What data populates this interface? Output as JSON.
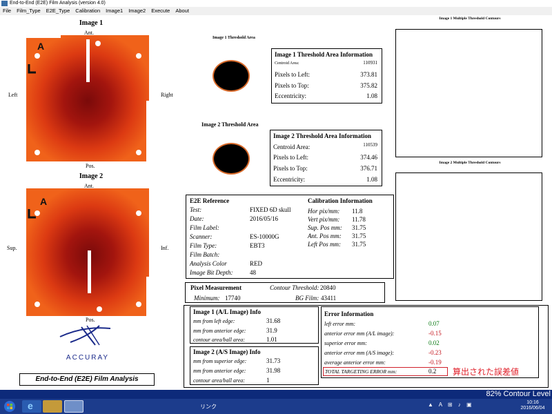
{
  "window": {
    "title": "End-to-End (E2E) Film Analysis (version 4.0)"
  },
  "menu": [
    "File",
    "Film_Type",
    "E2E_Type",
    "Calibration",
    "Image1",
    "Image2",
    "Execute",
    "About"
  ],
  "image1": {
    "title": "Image 1",
    "top": "Ant.",
    "bottom": "Pos.",
    "left": "Left",
    "right": "Right",
    "marker": "A"
  },
  "image2": {
    "title": "Image 2",
    "top": "Ant.",
    "bottom": "Pos.",
    "left": "Sup.",
    "right": "Inf.",
    "marker": "A"
  },
  "threshold1": {
    "caption": "Image 1 Threshold Area",
    "info_title": "Image 1 Threshold Area Information",
    "centroid_label": "Centroid Area:",
    "centroid_value": "110931",
    "left_label": "Pixels to Left:",
    "left_value": "373.81",
    "top_label": "Pixels to Top:",
    "top_value": "375.82",
    "ecc_label": "Eccentricity:",
    "ecc_value": "1.08"
  },
  "threshold2": {
    "caption": "Image 2 Threshold Area",
    "info_title": "Image 2 Threshold Area Information",
    "centroid_label": "Centroid Area:",
    "centroid_value": "110539",
    "left_label": "Pixels to Left:",
    "left_value": "374.46",
    "top_label": "Pixels to Top:",
    "top_value": "376.71",
    "ecc_label": "Eccentricity:",
    "ecc_value": "1.08"
  },
  "contours": {
    "image1_title": "Image 1 Multiple Threshold Contours",
    "image2_title": "Image 2 Multiple Threshold Contours"
  },
  "e2e_reference": {
    "title": "E2E Reference",
    "rows": [
      {
        "label": "Test:",
        "value": "FIXED 6D skull"
      },
      {
        "label": "Date:",
        "value": "2016/05/16"
      },
      {
        "label": "Film Label:",
        "value": ""
      },
      {
        "label": "Scanner:",
        "value": "ES-10000G"
      },
      {
        "label": "Film Type:",
        "value": "EBT3"
      },
      {
        "label": "Film Batch:",
        "value": ""
      },
      {
        "label": "Analysis Color",
        "value": "RED"
      },
      {
        "label": "Image Bit Depth:",
        "value": "48"
      }
    ]
  },
  "calibration": {
    "title": "Calibration Information",
    "rows": [
      {
        "label": "Hor pix/mm:",
        "value": "11.8"
      },
      {
        "label": "Vert pix/mm:",
        "value": "11.78"
      },
      {
        "label": "Sup. Pos mm:",
        "value": "31.75"
      },
      {
        "label": "Ant. Pos mm:",
        "value": "31.75"
      },
      {
        "label": "Left Pos mm:",
        "value": "31.75"
      }
    ]
  },
  "pixel_measurement": {
    "title": "Pixel Measurement",
    "contour_label": "Contour Threshold:",
    "contour_value": "20840",
    "min_label": "Minimum:",
    "min_value": "17740",
    "bg_label": "BG Film:",
    "bg_value": "43411"
  },
  "image1_info": {
    "title": "Image 1 (A/L Image) Info",
    "rows": [
      {
        "label": "mm from left edge:",
        "value": "31.68"
      },
      {
        "label": "mm from anterior edge:",
        "value": "31.9"
      },
      {
        "label": "contour area/ball area:",
        "value": "1.01"
      }
    ]
  },
  "image2_info": {
    "title": "Image 2 (A/S Image) Info",
    "rows": [
      {
        "label": "mm from superior edge:",
        "value": "31.73"
      },
      {
        "label": "mm from anterior edge:",
        "value": "31.98"
      },
      {
        "label": "contour area/ball area:",
        "value": "1"
      }
    ]
  },
  "error_info": {
    "title": "Error Information",
    "rows": [
      {
        "label": "left error mm:",
        "value": "0.07",
        "sign": "pos"
      },
      {
        "label": "anterior error mm (A/L image):",
        "value": "-0.15",
        "sign": "neg"
      },
      {
        "label": "superior error mm:",
        "value": "0.02",
        "sign": "pos"
      },
      {
        "label": "anterior error mm (A/S image):",
        "value": "-0.23",
        "sign": "neg"
      },
      {
        "label": "average anterior error mm:",
        "value": "-0.19",
        "sign": "neg"
      }
    ],
    "total_label": "TOTAL TARGETING ERROR mm:",
    "total_value": "0.2",
    "annotation": "算出された誤差値"
  },
  "branding": {
    "logo_text": "ACCURAY",
    "app_name": "End-to-End (E2E) Film Analysis"
  },
  "status": {
    "contour_level": "82% Contour Level"
  },
  "taskbar": {
    "link": "リンク",
    "time": "10:16",
    "date": "2016/06/04"
  }
}
